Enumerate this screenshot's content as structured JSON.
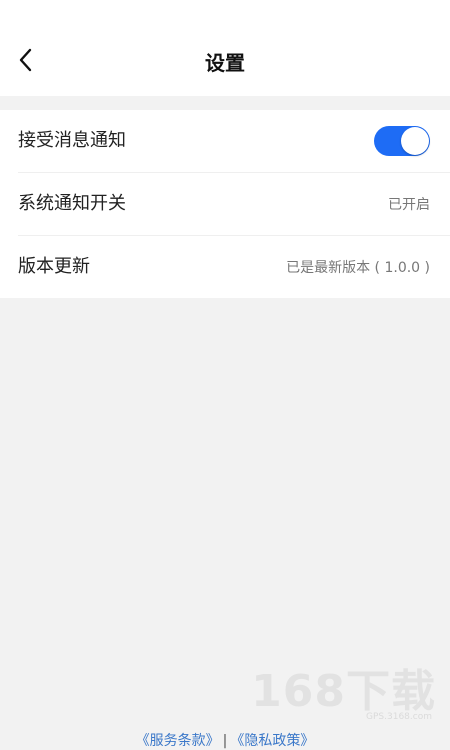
{
  "header": {
    "title": "设置",
    "back_icon": "chevron-left-icon"
  },
  "settings": {
    "message_notification": {
      "label": "接受消息通知",
      "enabled": true,
      "toggle_color": "#1e6cf5"
    },
    "system_notification": {
      "label": "系统通知开关",
      "value": "已开启"
    },
    "version_update": {
      "label": "版本更新",
      "value": "已是最新版本 ( 1.0.0 )"
    }
  },
  "footer": {
    "terms_link": "《服务条款》",
    "separator": "|",
    "privacy_link": "《隐私政策》",
    "link_color": "#3b78c9"
  },
  "watermark": {
    "main": "168下载",
    "sub": "GPS.3168.com"
  }
}
